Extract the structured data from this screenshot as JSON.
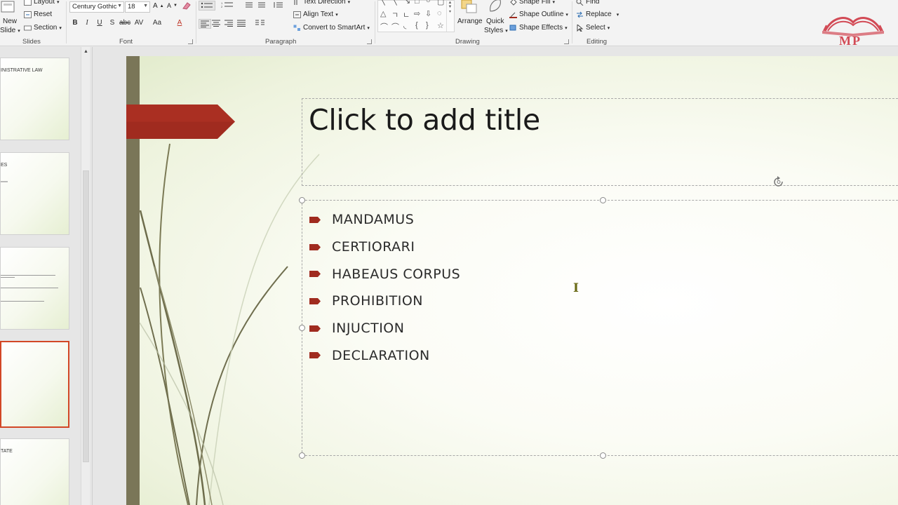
{
  "ribbon": {
    "slides": {
      "new_slide_line1": "New",
      "new_slide_line2": "Slide",
      "layout": "Layout",
      "reset": "Reset",
      "section": "Section",
      "group_label": "Slides"
    },
    "font": {
      "font_name": "Century Gothic",
      "font_size": "18",
      "group_label": "Font"
    },
    "paragraph": {
      "text_direction": "Text Direction",
      "align_text": "Align Text",
      "convert_smartart": "Convert to SmartArt",
      "group_label": "Paragraph"
    },
    "drawing": {
      "arrange": "Arrange",
      "quick_styles_line1": "Quick",
      "quick_styles_line2": "Styles",
      "shape_fill": "Shape Fill",
      "shape_outline": "Shape Outline",
      "shape_effects": "Shape Effects",
      "group_label": "Drawing"
    },
    "editing": {
      "find": "Find",
      "replace": "Replace",
      "select": "Select",
      "group_label": "Editing"
    }
  },
  "logo": {
    "text": "MP",
    "color": "#d24a55"
  },
  "thumbnails": [
    {
      "title": "INISTRATIVE LAW"
    },
    {
      "title": "ES"
    },
    {
      "title": ""
    },
    {
      "title": "",
      "selected": true
    },
    {
      "title": "TATE"
    }
  ],
  "slide": {
    "title_placeholder": "Click to add title",
    "bullets": [
      "MANDAMUS",
      "CERTIORARI",
      "HABEAUS CORPUS",
      "PROHIBITION",
      "INJUCTION",
      "DECLARATION"
    ],
    "accent_color": "#a02b1f",
    "bar_color": "#7a7658"
  }
}
